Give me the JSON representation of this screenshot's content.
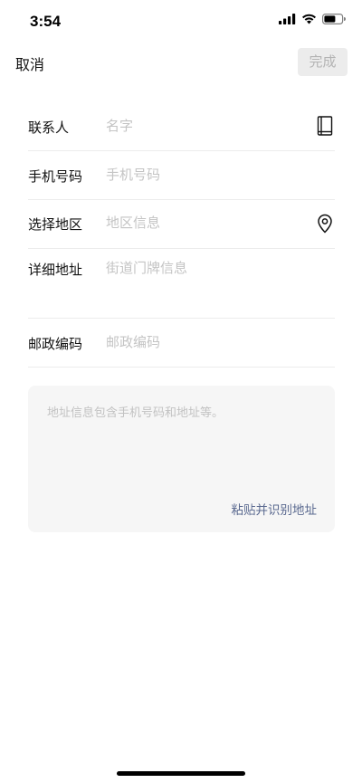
{
  "status_bar": {
    "time": "3:54"
  },
  "nav": {
    "cancel_label": "取消",
    "done_label": "完成"
  },
  "form": {
    "contact_label": "联系人",
    "contact_placeholder": "名字",
    "phone_label": "手机号码",
    "phone_placeholder": "手机号码",
    "region_label": "选择地区",
    "region_placeholder": "地区信息",
    "address_label": "详细地址",
    "address_placeholder": "街道门牌信息",
    "postcode_label": "邮政编码",
    "postcode_placeholder": "邮政编码"
  },
  "paste": {
    "placeholder": "地址信息包含手机号码和地址等。",
    "action_label": "粘贴并识别地址"
  },
  "icons": {
    "contact_book": "address-book-icon",
    "location": "location-pin-icon",
    "signal": "cellular-signal-icon",
    "wifi": "wifi-icon",
    "battery": "battery-icon"
  },
  "colors": {
    "link": "#5b6a90",
    "placeholder": "#c4c4c4",
    "done_bg": "#ececec",
    "done_text": "#b3b3b3",
    "paste_bg": "#f6f6f6"
  }
}
